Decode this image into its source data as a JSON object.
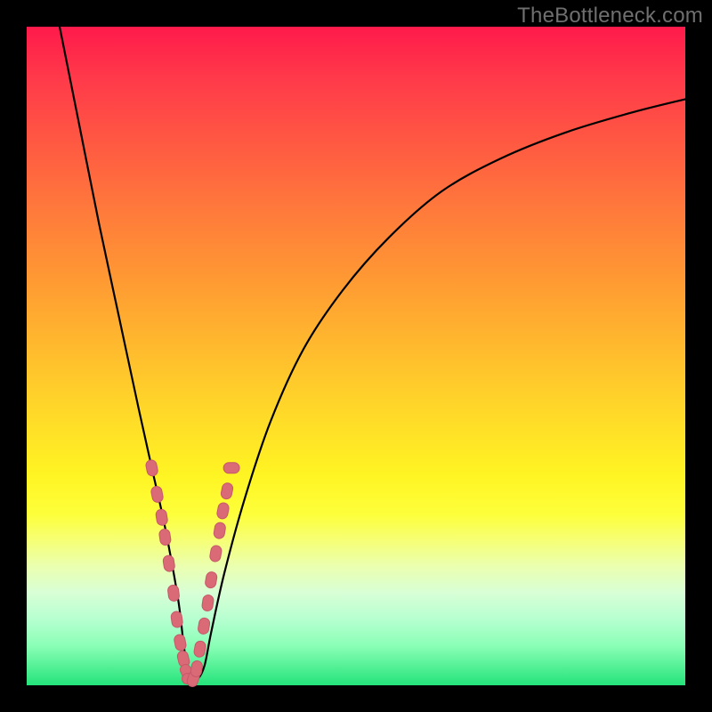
{
  "watermark": "TheBottleneck.com",
  "colors": {
    "frame": "#000000",
    "curve": "#000000",
    "marker_fill": "#d96a76",
    "marker_stroke": "#c6586a",
    "gradient_top": "#ff1a4b",
    "gradient_bottom": "#24e37a"
  },
  "chart_data": {
    "type": "line",
    "title": "",
    "xlabel": "",
    "ylabel": "",
    "xlim": [
      0,
      100
    ],
    "ylim": [
      0,
      100
    ],
    "note": "V-shaped bottleneck curve; y is approximate bottleneck % read from vertical position against gradient (0 = bottom/green, 100 = top/red). Minimum near x≈25.",
    "series": [
      {
        "name": "bottleneck-curve",
        "x": [
          5,
          8,
          11,
          14,
          17,
          19,
          21,
          23,
          24,
          25,
          26,
          27,
          28,
          30,
          33,
          37,
          42,
          48,
          55,
          63,
          72,
          82,
          92,
          100
        ],
        "y": [
          100,
          85,
          70,
          56,
          42,
          33,
          24,
          13,
          5,
          1,
          1,
          3,
          8,
          17,
          28,
          40,
          51,
          60,
          68,
          75,
          80,
          84,
          87,
          89
        ]
      }
    ],
    "markers": {
      "name": "highlighted-points",
      "x": [
        19.0,
        19.8,
        20.5,
        21.0,
        21.6,
        22.3,
        22.8,
        23.3,
        23.8,
        24.3,
        24.8,
        25.3,
        25.8,
        26.3,
        26.9,
        27.5,
        28.0,
        28.7,
        29.3,
        29.8,
        30.4,
        31.1
      ],
      "y": [
        33.0,
        29.0,
        25.5,
        22.5,
        18.5,
        14.0,
        10.0,
        6.5,
        4.0,
        2.0,
        1.0,
        1.0,
        2.5,
        5.5,
        9.0,
        12.5,
        16.0,
        20.0,
        23.5,
        26.5,
        29.5,
        33.0
      ]
    }
  }
}
